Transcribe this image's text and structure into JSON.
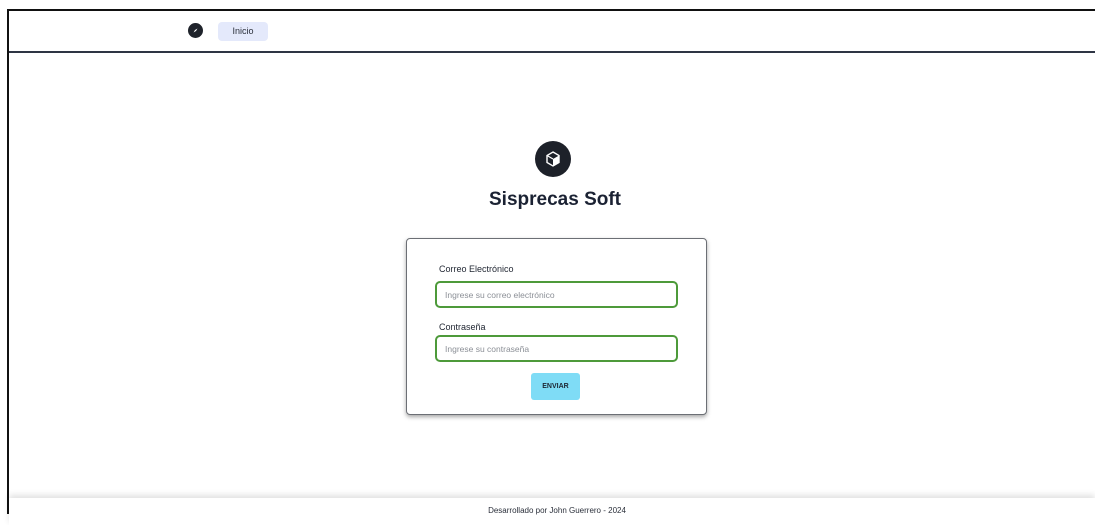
{
  "navbar": {
    "logo_icon": "compass-icon",
    "home_label": "Inicio"
  },
  "brand": {
    "icon": "cube-icon",
    "title": "Sisprecas Soft"
  },
  "login_form": {
    "email_label": "Correo Electrónico",
    "email_placeholder": "Ingrese su correo electrónico",
    "email_value": "",
    "password_label": "Contraseña",
    "password_placeholder": "Ingrese su contraseña",
    "password_value": "",
    "submit_label": "ENVIAR"
  },
  "footer": {
    "text": "Desarrollado por John Guerrero - 2024"
  },
  "colors": {
    "navbar_border": "#2e3544",
    "nav_button_bg": "#e4e9fb",
    "input_border": "#4d9a3a",
    "submit_bg": "#7fdcf6",
    "dark_icon": "#1d2129"
  }
}
